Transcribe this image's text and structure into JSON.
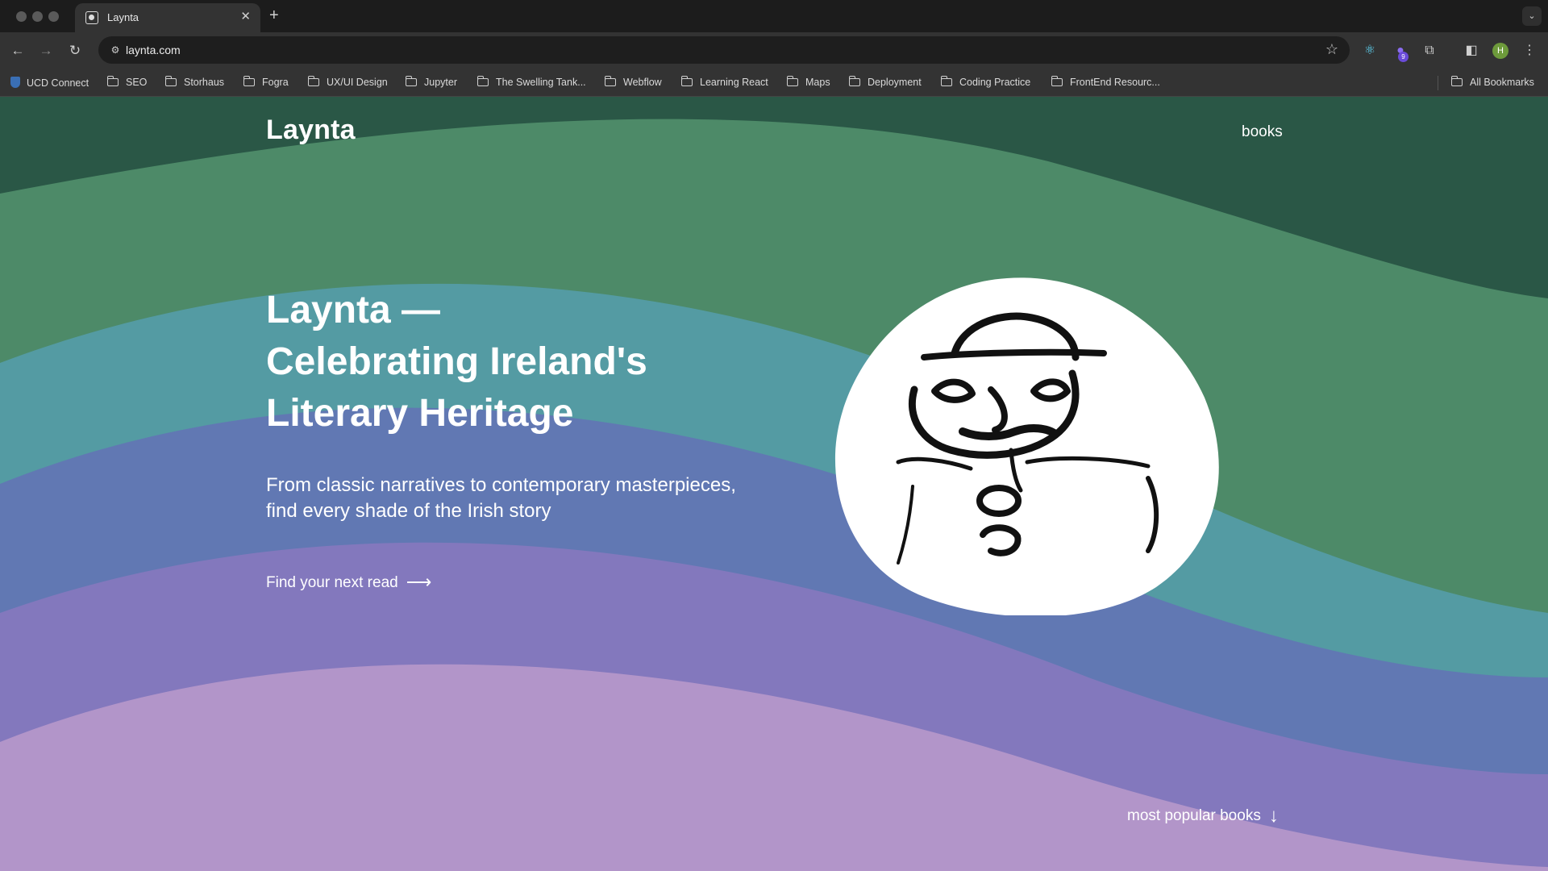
{
  "browser": {
    "tab_title": "Laynta",
    "url": "laynta.com",
    "extension_badge": "9",
    "profile_initial": "H",
    "bookmarks": [
      "UCD Connect",
      "SEO",
      "Storhaus",
      "Fogra",
      "UX/UI Design",
      "Jupyter",
      "The Swelling Tank...",
      "Webflow",
      "Learning React",
      "Maps",
      "Deployment",
      "Coding Practice",
      "FrontEnd Resourc..."
    ],
    "all_bookmarks": "All Bookmarks"
  },
  "site": {
    "logo": "Laynta",
    "nav_books": "books",
    "hero_title_line1": "Laynta —",
    "hero_title_line2": "Celebrating Ireland's",
    "hero_title_line3": "Literary Heritage",
    "hero_sub_line1": "From classic narratives to contemporary masterpieces,",
    "hero_sub_line2": "find every shade of the Irish story",
    "cta_label": "Find your next read",
    "cta_arrow": "⟶",
    "popular_label": "most popular books",
    "popular_arrow": "↓"
  },
  "colors": {
    "wave_dark_green": "#2a5746",
    "wave_green": "#3b745a",
    "wave_mid_green": "#4d8a68",
    "wave_teal": "#549ba3",
    "wave_blue": "#6178b3",
    "wave_purple": "#8378bd",
    "wave_lilac": "#b295c9",
    "illustration_bg": "#ffffff"
  }
}
